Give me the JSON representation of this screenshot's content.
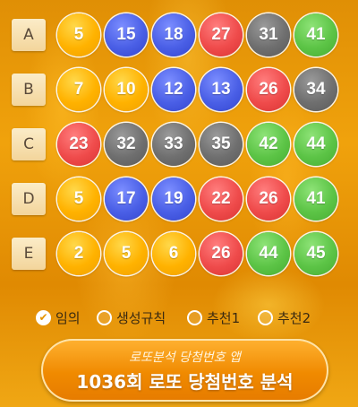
{
  "rows": [
    {
      "letter": "A",
      "balls": [
        {
          "n": "5",
          "c": "yellow"
        },
        {
          "n": "15",
          "c": "blue"
        },
        {
          "n": "18",
          "c": "blue"
        },
        {
          "n": "27",
          "c": "red"
        },
        {
          "n": "31",
          "c": "gray"
        },
        {
          "n": "41",
          "c": "green"
        }
      ]
    },
    {
      "letter": "B",
      "balls": [
        {
          "n": "7",
          "c": "yellow"
        },
        {
          "n": "10",
          "c": "yellow"
        },
        {
          "n": "12",
          "c": "blue"
        },
        {
          "n": "13",
          "c": "blue"
        },
        {
          "n": "26",
          "c": "red"
        },
        {
          "n": "34",
          "c": "gray"
        }
      ]
    },
    {
      "letter": "C",
      "balls": [
        {
          "n": "23",
          "c": "red"
        },
        {
          "n": "32",
          "c": "gray"
        },
        {
          "n": "33",
          "c": "gray"
        },
        {
          "n": "35",
          "c": "gray"
        },
        {
          "n": "42",
          "c": "green"
        },
        {
          "n": "44",
          "c": "green"
        }
      ]
    },
    {
      "letter": "D",
      "balls": [
        {
          "n": "5",
          "c": "yellow"
        },
        {
          "n": "17",
          "c": "blue"
        },
        {
          "n": "19",
          "c": "blue"
        },
        {
          "n": "22",
          "c": "red"
        },
        {
          "n": "26",
          "c": "red"
        },
        {
          "n": "41",
          "c": "green"
        }
      ]
    },
    {
      "letter": "E",
      "balls": [
        {
          "n": "2",
          "c": "yellow"
        },
        {
          "n": "5",
          "c": "yellow"
        },
        {
          "n": "6",
          "c": "yellow"
        },
        {
          "n": "26",
          "c": "red"
        },
        {
          "n": "44",
          "c": "green"
        },
        {
          "n": "45",
          "c": "green"
        }
      ]
    }
  ],
  "options": [
    {
      "label": "임의",
      "checked": true
    },
    {
      "label": "생성규칙",
      "checked": false
    },
    {
      "label": "추천1",
      "checked": false
    },
    {
      "label": "추천2",
      "checked": false
    }
  ],
  "cta": {
    "subtitle": "로또분석 당첨번호 앱",
    "title": "1036회 로또 당첨번호 분석"
  },
  "colors": {
    "yellow": "#ffb200",
    "blue": "#4a5fe6",
    "red": "#ef4b4b",
    "gray": "#6f6f6f",
    "green": "#5cc446",
    "accent": "#f08a00"
  }
}
